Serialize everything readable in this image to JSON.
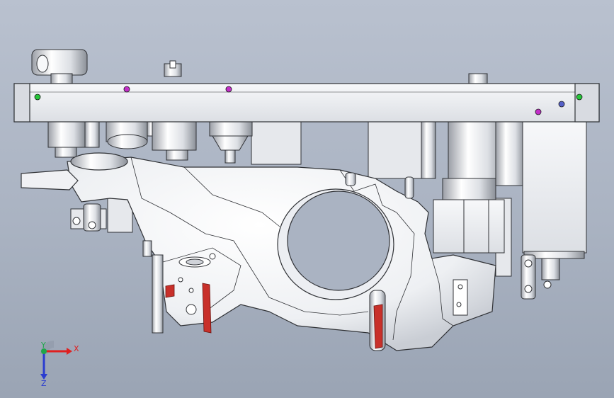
{
  "triad": {
    "x_label": "X",
    "y_label": "Y",
    "z_label": "Z",
    "x_color": "#e02020",
    "y_color": "#1fa64a",
    "z_color": "#2a3cd0"
  },
  "colors": {
    "background": "#aab3c2",
    "model_fill": "#f1f2f5",
    "edge": "#303236",
    "face_highlight": "#c8302a",
    "point_magenta": "#c22fc8",
    "point_green": "#27c53a",
    "point_blue": "#5560c8"
  }
}
